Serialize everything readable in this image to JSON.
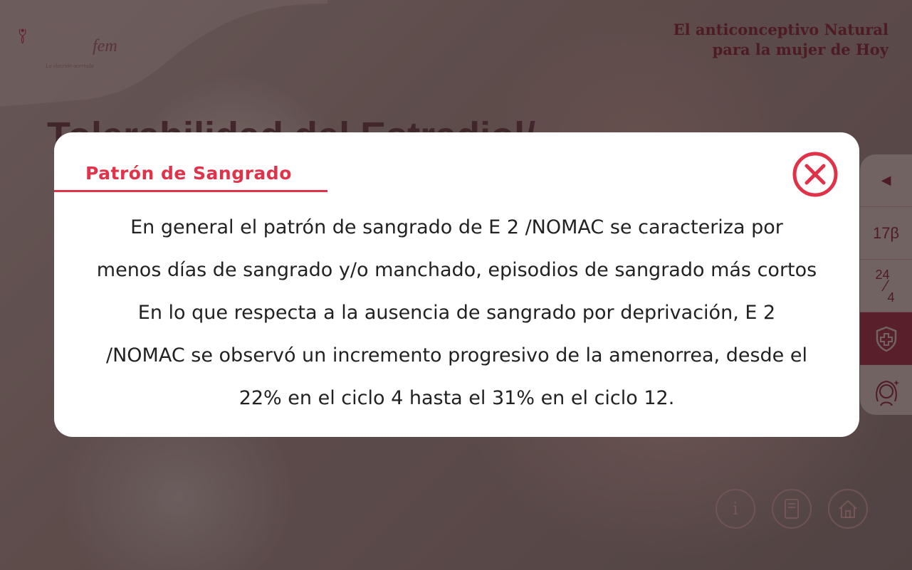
{
  "brand": {
    "logo_name_1": "index",
    "logo_name_2": "fem",
    "logo_tagline": "La elección acertada",
    "tagline_line1": "El anticonceptivo Natural",
    "tagline_line2": "para la mujer de Hoy"
  },
  "background": {
    "title": "Tolerabilidad del Estradiol/"
  },
  "side_panel": {
    "items": [
      {
        "label": "◀",
        "icon": "chevron-left-icon"
      },
      {
        "label": "17β"
      },
      {
        "label_top": "24",
        "label_bottom": "4"
      },
      {
        "icon": "shield-cross-icon"
      },
      {
        "icon": "woman-icon"
      }
    ]
  },
  "bottom_nav": {
    "info_label": "i",
    "icons": [
      "info-icon",
      "book-icon",
      "home-icon"
    ]
  },
  "modal": {
    "title": "Patrón de Sangrado",
    "close_icon": "close-icon",
    "accent_color": "#e0334a",
    "lines": [
      "En general el patrón de sangrado de E 2 /NOMAC se caracteriza por",
      "menos días de sangrado y/o manchado, episodios de sangrado más cortos",
      "En lo que respecta a la ausencia de sangrado por deprivación, E 2",
      "/NOMAC se observó un incremento progresivo de la amenorrea, desde el",
      "22% en el ciclo 4 hasta el 31% en el ciclo 12."
    ]
  }
}
